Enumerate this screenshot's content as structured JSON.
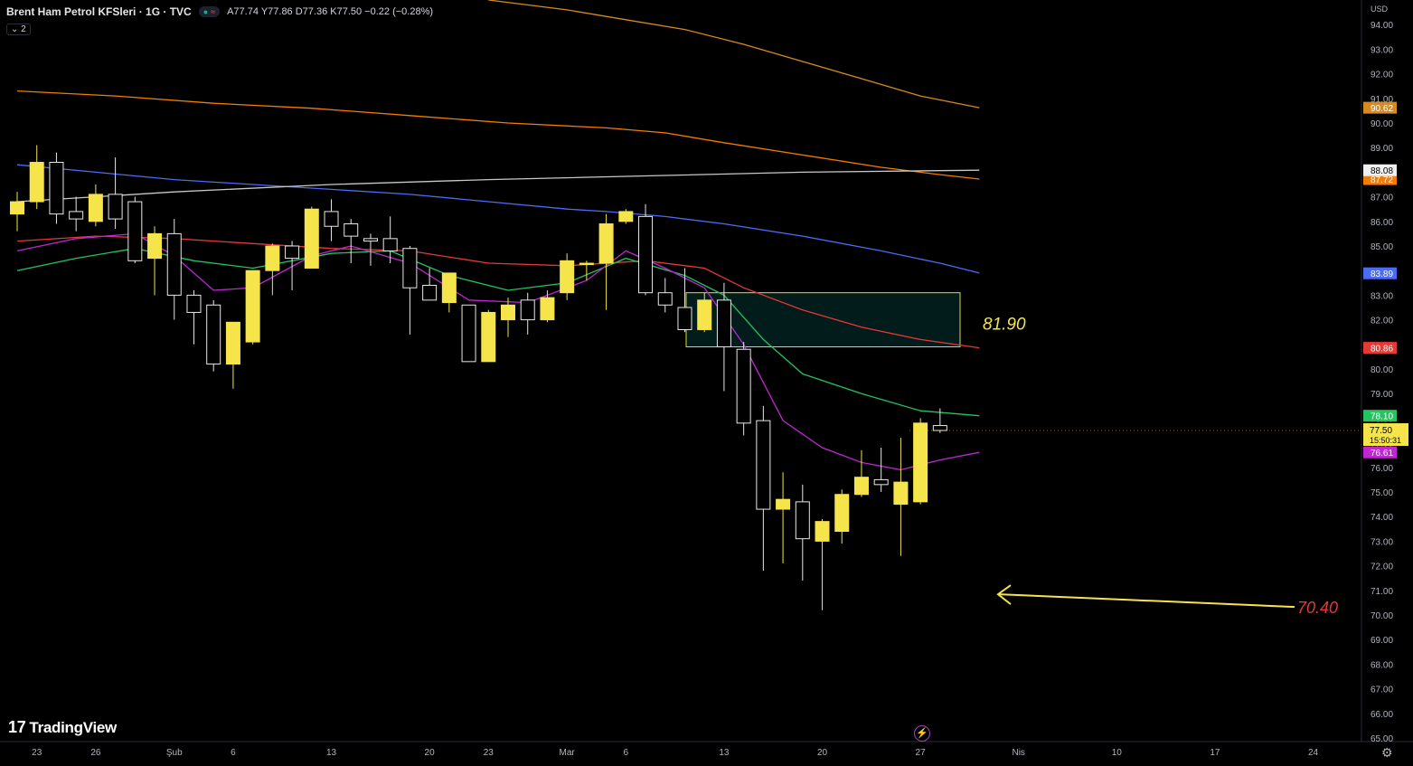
{
  "header": {
    "title": "Brent Ham Petrol KFSleri · 1G · TVC",
    "ohlc": "A77.74 Y77.86 D77.36 K77.50 −0.22 (−0.28%)",
    "collapse_label": "2"
  },
  "currency": "USD",
  "logo_text": "TradingView",
  "chart_data": {
    "type": "candlestick",
    "ylim": [
      65,
      94.5
    ],
    "y_ticks": [
      "65.00",
      "66.00",
      "67.00",
      "68.00",
      "69.00",
      "70.00",
      "71.00",
      "72.00",
      "73.00",
      "74.00",
      "75.00",
      "76.00",
      "77.00",
      "78.00",
      "79.00",
      "80.00",
      "81.00",
      "82.00",
      "83.00",
      "84.00",
      "85.00",
      "86.00",
      "87.00",
      "88.00",
      "89.00",
      "90.00",
      "91.00",
      "92.00",
      "93.00",
      "94.00"
    ],
    "x_ticks": [
      {
        "label": "23",
        "i": 1
      },
      {
        "label": "26",
        "i": 4
      },
      {
        "label": "Şub",
        "i": 8
      },
      {
        "label": "6",
        "i": 11
      },
      {
        "label": "13",
        "i": 16
      },
      {
        "label": "20",
        "i": 21
      },
      {
        "label": "23",
        "i": 24
      },
      {
        "label": "Mar",
        "i": 28
      },
      {
        "label": "6",
        "i": 31
      },
      {
        "label": "13",
        "i": 36
      },
      {
        "label": "20",
        "i": 41
      },
      {
        "label": "27",
        "i": 46
      },
      {
        "label": "Nis",
        "i": 51
      },
      {
        "label": "10",
        "i": 56
      },
      {
        "label": "17",
        "i": 61
      },
      {
        "label": "24",
        "i": 66
      }
    ],
    "candles": [
      [
        86.3,
        87.2,
        85.6,
        86.8
      ],
      [
        86.8,
        89.1,
        86.5,
        88.4
      ],
      [
        88.4,
        88.8,
        85.9,
        86.3
      ],
      [
        86.4,
        87.0,
        85.6,
        86.1
      ],
      [
        86.0,
        87.5,
        85.8,
        87.1
      ],
      [
        87.1,
        88.6,
        85.7,
        86.1
      ],
      [
        86.8,
        87.0,
        84.3,
        84.4
      ],
      [
        84.5,
        85.8,
        83.0,
        85.5
      ],
      [
        85.5,
        86.1,
        82.0,
        83.0
      ],
      [
        83.0,
        83.2,
        81.0,
        82.3
      ],
      [
        82.6,
        82.8,
        79.9,
        80.2
      ],
      [
        80.2,
        81.0,
        79.2,
        81.9
      ],
      [
        81.1,
        84.0,
        81.0,
        84.0
      ],
      [
        84.0,
        85.1,
        83.0,
        85.0
      ],
      [
        85.0,
        85.2,
        83.2,
        84.5
      ],
      [
        84.1,
        86.6,
        84.1,
        86.5
      ],
      [
        86.4,
        86.9,
        85.2,
        85.8
      ],
      [
        85.9,
        86.1,
        84.3,
        85.4
      ],
      [
        85.3,
        85.5,
        84.2,
        85.2
      ],
      [
        85.3,
        86.2,
        84.3,
        84.8
      ],
      [
        84.9,
        85.0,
        81.4,
        83.3
      ],
      [
        83.4,
        84.1,
        82.8,
        82.8
      ],
      [
        82.7,
        83.5,
        82.3,
        83.9
      ],
      [
        82.6,
        82.6,
        80.3,
        80.3
      ],
      [
        80.3,
        82.4,
        80.3,
        82.3
      ],
      [
        82.0,
        82.9,
        81.3,
        82.6
      ],
      [
        82.8,
        83.1,
        81.4,
        82.0
      ],
      [
        82.0,
        83.2,
        81.9,
        82.9
      ],
      [
        83.1,
        84.7,
        82.8,
        84.4
      ],
      [
        84.3,
        84.4,
        83.6,
        84.3
      ],
      [
        84.3,
        86.3,
        82.4,
        85.9
      ],
      [
        86.0,
        86.5,
        85.9,
        86.4
      ],
      [
        86.2,
        86.7,
        83.0,
        83.1
      ],
      [
        83.1,
        83.7,
        82.3,
        82.6
      ],
      [
        82.5,
        84.1,
        81.5,
        81.6
      ],
      [
        81.6,
        83.1,
        81.5,
        82.8
      ],
      [
        82.8,
        83.5,
        79.1,
        80.9
      ],
      [
        80.8,
        81.1,
        77.3,
        77.8
      ],
      [
        77.9,
        78.5,
        71.8,
        74.3
      ],
      [
        74.3,
        75.8,
        72.1,
        74.7
      ],
      [
        74.6,
        75.3,
        71.4,
        73.1
      ],
      [
        73.0,
        73.9,
        70.2,
        73.8
      ],
      [
        73.4,
        75.1,
        72.9,
        74.9
      ],
      [
        74.9,
        76.7,
        74.8,
        75.6
      ],
      [
        75.5,
        76.8,
        75.0,
        75.3
      ],
      [
        74.5,
        77.2,
        72.4,
        75.4
      ],
      [
        74.6,
        78.0,
        74.5,
        77.8
      ],
      [
        77.7,
        78.4,
        77.4,
        77.5
      ]
    ],
    "moving_averages": [
      {
        "color": "#4a6cf7",
        "last": "83.89",
        "path": [
          [
            0,
            88.3
          ],
          [
            4,
            88.0
          ],
          [
            8,
            87.7
          ],
          [
            12,
            87.5
          ],
          [
            16,
            87.3
          ],
          [
            20,
            87.1
          ],
          [
            24,
            86.8
          ],
          [
            28,
            86.5
          ],
          [
            30,
            86.4
          ],
          [
            33,
            86.2
          ],
          [
            36,
            85.9
          ],
          [
            40,
            85.4
          ],
          [
            44,
            84.8
          ],
          [
            47,
            84.3
          ],
          [
            49,
            83.9
          ]
        ]
      },
      {
        "color": "#f57c00",
        "last": "87.72",
        "path": [
          [
            0,
            91.3
          ],
          [
            5,
            91.1
          ],
          [
            10,
            90.8
          ],
          [
            15,
            90.6
          ],
          [
            20,
            90.3
          ],
          [
            25,
            90.0
          ],
          [
            30,
            89.8
          ],
          [
            33,
            89.6
          ],
          [
            36,
            89.2
          ],
          [
            40,
            88.7
          ],
          [
            44,
            88.2
          ],
          [
            47,
            87.9
          ],
          [
            49,
            87.72
          ]
        ]
      },
      {
        "color": "#d88a1e",
        "last": "90.62",
        "path": [
          [
            24,
            95.0
          ],
          [
            28,
            94.6
          ],
          [
            31,
            94.2
          ],
          [
            34,
            93.8
          ],
          [
            37,
            93.2
          ],
          [
            40,
            92.5
          ],
          [
            43,
            91.8
          ],
          [
            46,
            91.1
          ],
          [
            49,
            90.62
          ]
        ]
      },
      {
        "color": "#c8c8c8",
        "last": "88.08",
        "path": [
          [
            0,
            86.8
          ],
          [
            8,
            87.2
          ],
          [
            16,
            87.5
          ],
          [
            24,
            87.7
          ],
          [
            32,
            87.85
          ],
          [
            40,
            88.0
          ],
          [
            49,
            88.08
          ]
        ]
      },
      {
        "color": "#e53935",
        "last": "80.86",
        "path": [
          [
            0,
            85.2
          ],
          [
            4,
            85.4
          ],
          [
            8,
            85.3
          ],
          [
            12,
            85.1
          ],
          [
            16,
            84.9
          ],
          [
            20,
            84.8
          ],
          [
            24,
            84.3
          ],
          [
            28,
            84.2
          ],
          [
            32,
            84.4
          ],
          [
            35,
            84.1
          ],
          [
            37,
            83.3
          ],
          [
            40,
            82.4
          ],
          [
            43,
            81.7
          ],
          [
            46,
            81.2
          ],
          [
            49,
            80.86
          ]
        ]
      },
      {
        "color": "#22c55e",
        "last": "78.10",
        "path": [
          [
            0,
            84.0
          ],
          [
            3,
            84.5
          ],
          [
            6,
            84.9
          ],
          [
            9,
            84.4
          ],
          [
            12,
            84.1
          ],
          [
            16,
            84.7
          ],
          [
            19,
            84.8
          ],
          [
            22,
            83.8
          ],
          [
            25,
            83.2
          ],
          [
            28,
            83.5
          ],
          [
            31,
            84.5
          ],
          [
            34,
            83.8
          ],
          [
            36,
            83.0
          ],
          [
            38,
            81.2
          ],
          [
            40,
            79.8
          ],
          [
            43,
            79.0
          ],
          [
            46,
            78.3
          ],
          [
            49,
            78.1
          ]
        ]
      },
      {
        "color": "#c026d3",
        "last": "76.61",
        "path": [
          [
            0,
            84.8
          ],
          [
            3,
            85.3
          ],
          [
            6,
            85.5
          ],
          [
            8,
            84.6
          ],
          [
            10,
            83.2
          ],
          [
            12,
            83.3
          ],
          [
            15,
            84.6
          ],
          [
            17,
            85.0
          ],
          [
            20,
            84.3
          ],
          [
            23,
            82.8
          ],
          [
            26,
            82.7
          ],
          [
            29,
            83.6
          ],
          [
            31,
            84.8
          ],
          [
            33,
            84.1
          ],
          [
            35,
            83.3
          ],
          [
            37,
            81.0
          ],
          [
            39,
            77.9
          ],
          [
            41,
            76.8
          ],
          [
            43,
            76.2
          ],
          [
            45,
            75.9
          ],
          [
            47,
            76.3
          ],
          [
            49,
            76.61
          ]
        ]
      }
    ],
    "current_price": "77.50",
    "countdown": "15:50:31",
    "zone": {
      "top": 83.1,
      "bottom": 80.9,
      "label": "81.90"
    },
    "target": {
      "value": 70.4,
      "label": "70.40"
    }
  }
}
